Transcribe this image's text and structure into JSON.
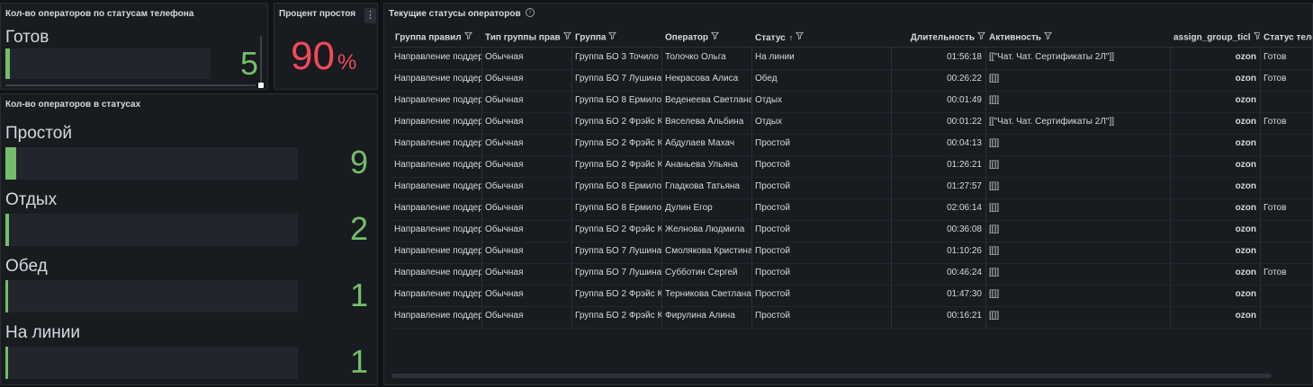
{
  "phone_panel": {
    "title": "Кол-во операторов по статусам телефона",
    "items": [
      {
        "label": "Готов",
        "value": "5",
        "fill": 0.02
      }
    ]
  },
  "idle_panel": {
    "title": "Процент простоя",
    "menu_icon": "kebab-icon",
    "value": "90",
    "unit": "%",
    "color": "#f2495c"
  },
  "status_panel": {
    "title": "Кол-во операторов в статусах",
    "items": [
      {
        "label": "Простой",
        "value": "9",
        "fill": 0.036
      },
      {
        "label": "Отдых",
        "value": "2",
        "fill": 0.012
      },
      {
        "label": "Обед",
        "value": "1",
        "fill": 0.006
      },
      {
        "label": "На линии",
        "value": "1",
        "fill": 0.006
      }
    ]
  },
  "accent_color": "#73bf69",
  "table_panel": {
    "title": "Текущие статусы операторов",
    "info_icon": "info-icon",
    "columns": [
      {
        "label": "Группа правил",
        "filter": true
      },
      {
        "label": "Тип группы прав",
        "filter": true
      },
      {
        "label": "Группа",
        "filter": true
      },
      {
        "label": "Оператор",
        "filter": true
      },
      {
        "label": "Статус",
        "filter": true,
        "sort": "asc"
      },
      {
        "label": "Длительность",
        "filter": true
      },
      {
        "label": "Активность",
        "filter": true
      },
      {
        "label": "assign_group_ticl",
        "filter": true
      },
      {
        "label": "Статус теле",
        "filter": true
      }
    ],
    "rows": [
      [
        "Направление поддер",
        "Обычная",
        "Группа БО 3 Точило",
        "Толочко Ольга",
        "На линии",
        "01:56:18",
        "[[\"Чат. Чат. Сертификаты 2Л\"]]",
        "ozon",
        "Готов"
      ],
      [
        "Направление поддер",
        "Обычная",
        "Группа БО 7 Лушина",
        "Некрасова Алиса",
        "Обед",
        "00:26:22",
        "[[]]",
        "ozon",
        "Готов"
      ],
      [
        "Направление поддер",
        "Обычная",
        "Группа БО 8 Ермило",
        "Веденеева Светлана",
        "Отдых",
        "00:01:49",
        "[[]]",
        "ozon",
        ""
      ],
      [
        "Направление поддер",
        "Обычная",
        "Группа БО 2 Фрэйс К",
        "Вяселева Альбина",
        "Отдых",
        "00:01:22",
        "[[\"Чат. Чат. Сертификаты 2Л\"]]",
        "ozon",
        "Готов"
      ],
      [
        "Направление поддер",
        "Обычная",
        "Группа БО 2 Фрэйс К",
        "Абдулаев Махач",
        "Простой",
        "00:04:13",
        "[[]]",
        "ozon",
        ""
      ],
      [
        "Направление поддер",
        "Обычная",
        "Группа БО 2 Фрэйс К",
        "Ананьева Ульяна",
        "Простой",
        "01:26:21",
        "[[]]",
        "ozon",
        ""
      ],
      [
        "Направление поддер",
        "Обычная",
        "Группа БО 8 Ермило",
        "Гладкова Татьяна",
        "Простой",
        "01:27:57",
        "[[]]",
        "ozon",
        ""
      ],
      [
        "Направление поддер",
        "Обычная",
        "Группа БО 8 Ермило",
        "Дулин Егор",
        "Простой",
        "02:06:14",
        "[[]]",
        "ozon",
        "Готов"
      ],
      [
        "Направление поддер",
        "Обычная",
        "Группа БО 2 Фрэйс К",
        "Желнова Людмила",
        "Простой",
        "00:36:08",
        "[[]]",
        "ozon",
        ""
      ],
      [
        "Направление поддер",
        "Обычная",
        "Группа БО 7 Лушина",
        "Смолякова Кристина",
        "Простой",
        "01:10:26",
        "[[]]",
        "ozon",
        ""
      ],
      [
        "Направление поддер",
        "Обычная",
        "Группа БО 7 Лушина",
        "Субботин Сергей",
        "Простой",
        "00:46:24",
        "[[]]",
        "ozon",
        "Готов"
      ],
      [
        "Направление поддер",
        "Обычная",
        "Группа БО 2 Фрэйс К",
        "Терникова Светлана",
        "Простой",
        "01:47:30",
        "[[]]",
        "ozon",
        ""
      ],
      [
        "Направление поддер",
        "Обычная",
        "Группа БО 2 Фрэйс К",
        "Фирулина Алина",
        "Простой",
        "00:16:21",
        "[[]]",
        "ozon",
        ""
      ]
    ]
  }
}
